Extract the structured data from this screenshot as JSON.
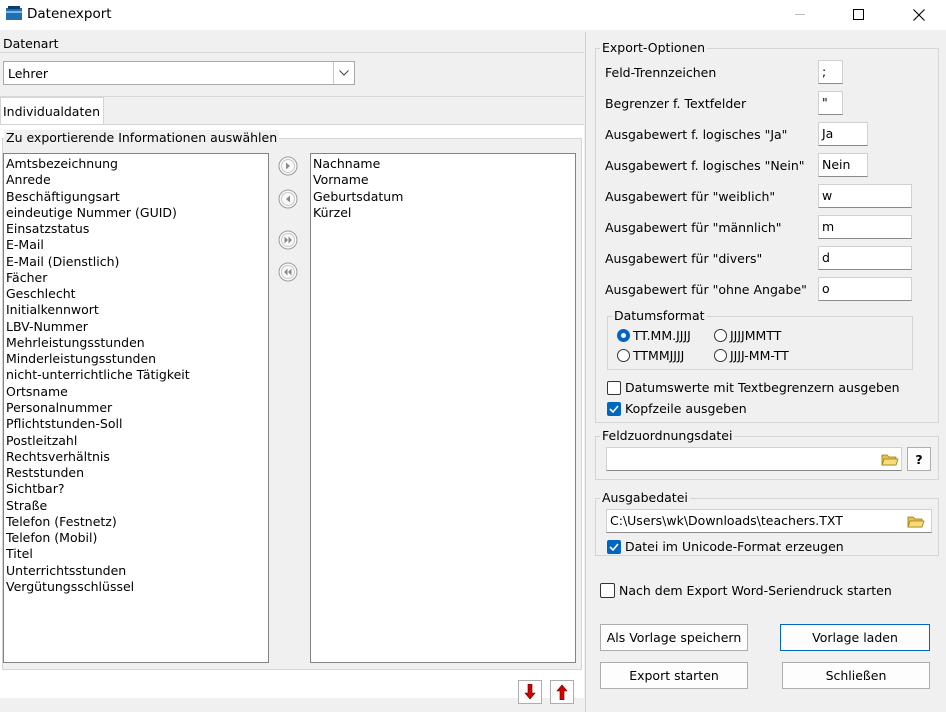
{
  "window": {
    "title": "Datenexport"
  },
  "datenart": {
    "label": "Datenart",
    "value": "Lehrer"
  },
  "tab": {
    "label": "Individualdaten"
  },
  "selection": {
    "group_label": "Zu exportierende Informationen auswählen",
    "available": [
      "Amtsbezeichnung",
      "Anrede",
      "Beschäftigungsart",
      "eindeutige Nummer (GUID)",
      "Einsatzstatus",
      "E-Mail",
      "E-Mail (Dienstlich)",
      "Fächer",
      "Geschlecht",
      "Initialkennwort",
      "LBV-Nummer",
      "Mehrleistungsstunden",
      "Minderleistungsstunden",
      "nicht-unterrichtliche Tätigkeit",
      "Ortsname",
      "Personalnummer",
      "Pflichtstunden-Soll",
      "Postleitzahl",
      "Rechtsverhältnis",
      "Reststunden",
      "Sichtbar?",
      "Straße",
      "Telefon (Festnetz)",
      "Telefon (Mobil)",
      "Titel",
      "Unterrichtsstunden",
      "Vergütungsschlüssel"
    ],
    "selected": [
      "Nachname",
      "Vorname",
      "Geburtsdatum",
      "Kürzel"
    ]
  },
  "export_options": {
    "group_label": "Export-Optionen",
    "fields": [
      {
        "label": "Feld-Trennzeichen",
        "value": ";"
      },
      {
        "label": "Begrenzer f. Textfelder",
        "value": "\""
      },
      {
        "label": "Ausgabewert f. logisches \"Ja\"",
        "value": "Ja"
      },
      {
        "label": "Ausgabewert f. logisches \"Nein\"",
        "value": "Nein"
      },
      {
        "label": "Ausgabewert für \"weiblich\"",
        "value": "w"
      },
      {
        "label": "Ausgabewert für \"männlich\"",
        "value": "m"
      },
      {
        "label": "Ausgabewert für \"divers\"",
        "value": "d"
      },
      {
        "label": "Ausgabewert für \"ohne Angabe\"",
        "value": "o"
      }
    ],
    "date_format": {
      "label": "Datumsformat",
      "options": [
        "TT.MM.JJJJ",
        "JJJJMMTT",
        "TTMMJJJJ",
        "JJJJ-MM-TT"
      ],
      "selected": "TT.MM.JJJJ"
    },
    "date_with_delimiter": {
      "label": "Datumswerte mit Textbegrenzern ausgeben",
      "checked": false
    },
    "header_line": {
      "label": "Kopfzeile ausgeben",
      "checked": true
    }
  },
  "mapping_file": {
    "label": "Feldzuordnungsdatei",
    "value": "",
    "help": "?"
  },
  "output_file": {
    "label": "Ausgabedatei",
    "value": "C:\\Users\\wk\\Downloads\\teachers.TXT",
    "unicode": {
      "label": "Datei im Unicode-Format erzeugen",
      "checked": true
    }
  },
  "word_merge": {
    "label": "Nach dem Export Word-Seriendruck starten",
    "checked": false
  },
  "buttons": {
    "save_template": "Als Vorlage speichern",
    "load_template": "Vorlage laden",
    "start_export": "Export starten",
    "close": "Schließen"
  },
  "colors": {
    "accent": "#0067c0",
    "arrow_red": "#d40000"
  }
}
